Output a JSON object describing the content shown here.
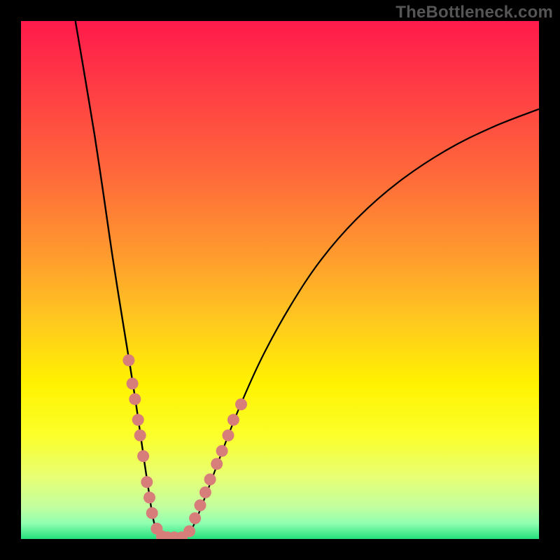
{
  "watermark": "TheBottleneck.com",
  "colors": {
    "frame": "#000000",
    "curve": "#000000",
    "dot_fill": "#d87e7a",
    "dot_stroke": "#b05851",
    "gradient_stops": [
      {
        "offset": "0%",
        "color": "#ff1a4b"
      },
      {
        "offset": "14%",
        "color": "#ff3f44"
      },
      {
        "offset": "30%",
        "color": "#ff6a3a"
      },
      {
        "offset": "45%",
        "color": "#ff9a2e"
      },
      {
        "offset": "58%",
        "color": "#ffc91f"
      },
      {
        "offset": "70%",
        "color": "#fff200"
      },
      {
        "offset": "80%",
        "color": "#fbff2a"
      },
      {
        "offset": "88%",
        "color": "#e8ff74"
      },
      {
        "offset": "94%",
        "color": "#c0ffa0"
      },
      {
        "offset": "97%",
        "color": "#8fffb0"
      },
      {
        "offset": "100%",
        "color": "#24e07c"
      }
    ]
  },
  "chart_data": {
    "type": "line",
    "title": "",
    "xlabel": "",
    "ylabel": "",
    "ylim": [
      0,
      100
    ],
    "xlim": [
      0,
      100
    ],
    "series": [
      {
        "name": "left-curve",
        "points": [
          {
            "x": 10.5,
            "y": 100
          },
          {
            "x": 12.2,
            "y": 90
          },
          {
            "x": 14.2,
            "y": 78
          },
          {
            "x": 16.0,
            "y": 66
          },
          {
            "x": 17.6,
            "y": 55
          },
          {
            "x": 19.0,
            "y": 46
          },
          {
            "x": 20.3,
            "y": 38
          },
          {
            "x": 21.6,
            "y": 30
          },
          {
            "x": 22.8,
            "y": 22
          },
          {
            "x": 23.8,
            "y": 15
          },
          {
            "x": 24.7,
            "y": 9
          },
          {
            "x": 25.5,
            "y": 4
          },
          {
            "x": 26.4,
            "y": 1
          },
          {
            "x": 27.6,
            "y": 0
          }
        ]
      },
      {
        "name": "right-curve",
        "points": [
          {
            "x": 27.6,
            "y": 0
          },
          {
            "x": 31.0,
            "y": 0
          },
          {
            "x": 33.0,
            "y": 2
          },
          {
            "x": 35.5,
            "y": 8
          },
          {
            "x": 38.5,
            "y": 16
          },
          {
            "x": 42.0,
            "y": 25
          },
          {
            "x": 46.5,
            "y": 35
          },
          {
            "x": 52.0,
            "y": 45
          },
          {
            "x": 58.0,
            "y": 54
          },
          {
            "x": 65.0,
            "y": 62
          },
          {
            "x": 73.0,
            "y": 69
          },
          {
            "x": 82.0,
            "y": 75
          },
          {
            "x": 91.0,
            "y": 79.5
          },
          {
            "x": 100.0,
            "y": 83
          }
        ]
      },
      {
        "name": "dots",
        "style": "scatter",
        "points": [
          {
            "x": 20.8,
            "y": 34.5
          },
          {
            "x": 21.5,
            "y": 30.0
          },
          {
            "x": 22.0,
            "y": 27.0
          },
          {
            "x": 22.6,
            "y": 23.0
          },
          {
            "x": 23.0,
            "y": 20.0
          },
          {
            "x": 23.6,
            "y": 16.0
          },
          {
            "x": 24.3,
            "y": 11.0
          },
          {
            "x": 24.8,
            "y": 8.0
          },
          {
            "x": 25.3,
            "y": 5.0
          },
          {
            "x": 26.2,
            "y": 2.0
          },
          {
            "x": 27.2,
            "y": 0.5
          },
          {
            "x": 28.3,
            "y": 0.3
          },
          {
            "x": 29.6,
            "y": 0.3
          },
          {
            "x": 31.0,
            "y": 0.3
          },
          {
            "x": 32.5,
            "y": 1.5
          },
          {
            "x": 33.6,
            "y": 4.0
          },
          {
            "x": 34.6,
            "y": 6.5
          },
          {
            "x": 35.6,
            "y": 9.0
          },
          {
            "x": 36.5,
            "y": 11.5
          },
          {
            "x": 37.8,
            "y": 14.5
          },
          {
            "x": 38.8,
            "y": 17.0
          },
          {
            "x": 40.0,
            "y": 20.0
          },
          {
            "x": 41.0,
            "y": 23.0
          },
          {
            "x": 42.5,
            "y": 26.0
          }
        ]
      }
    ]
  }
}
